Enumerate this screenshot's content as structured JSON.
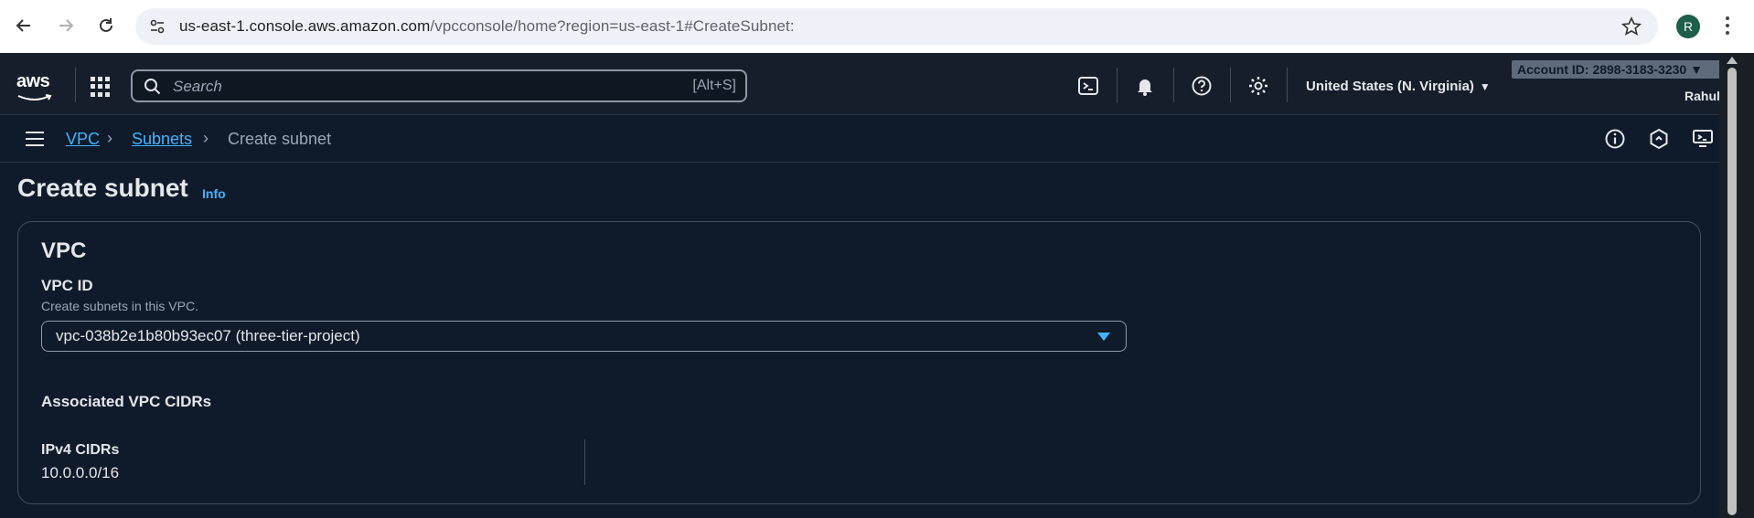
{
  "browser": {
    "url_host": "us-east-1.console.aws.amazon.com",
    "url_path": "/vpcconsole/home?region=us-east-1#CreateSubnet:",
    "profile_initial": "R"
  },
  "topnav": {
    "logo_text": "aws",
    "search_placeholder": "Search",
    "search_shortcut": "[Alt+S]",
    "region": "United States (N. Virginia)",
    "account_id": "Account ID: 2898-3183-3230",
    "username": "Rahul"
  },
  "breadcrumb": {
    "items": [
      "VPC",
      "Subnets",
      "Create subnet"
    ]
  },
  "page": {
    "title": "Create subnet",
    "info_link": "Info"
  },
  "vpc_section": {
    "heading": "VPC",
    "vpc_id_label": "VPC ID",
    "vpc_id_description": "Create subnets in this VPC.",
    "vpc_id_value": "vpc-038b2e1b80b93ec07 (three-tier-project)",
    "associated_heading": "Associated VPC CIDRs",
    "ipv4_label": "IPv4 CIDRs",
    "ipv4_value": "10.0.0.0/16"
  },
  "colors": {
    "accent": "#42b4ff",
    "background": "#0f1b2a",
    "topnav": "#161e2b"
  }
}
